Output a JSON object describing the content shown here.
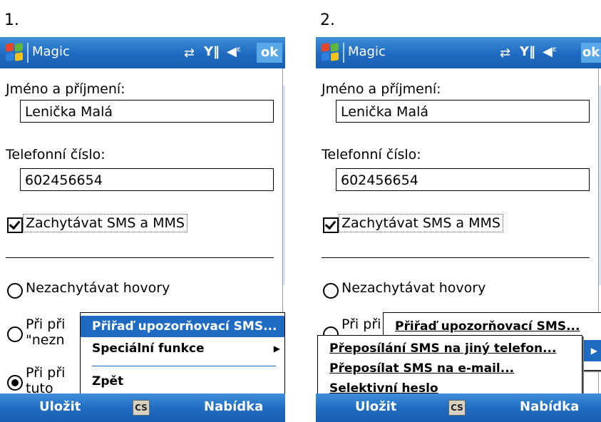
{
  "steps": [
    "1.",
    "2."
  ],
  "app_title": "Magic",
  "ok_label": "ok",
  "form": {
    "name_label": "Jméno a příjmení:",
    "name_value": "Lenička Malá",
    "phone_label": "Telefonní číslo:",
    "phone_value": "602456654",
    "checkbox_label": "Zachytávat SMS a MMS",
    "checkbox_checked": true,
    "radio1_label": "Nezachytávat hovory",
    "radio2_label_l1": "Při při",
    "radio2_label_l2": "\"nezn",
    "radio3_label_l1": "Při při",
    "radio3_label_l2": "tuto"
  },
  "menu1": {
    "items": [
      "Přiřaď upozorňovací SMS...",
      "Speciální funkce",
      "Zpět"
    ]
  },
  "menu2": {
    "top_item": "Přiřaď upozorňovací SMS...",
    "sub_items": [
      "Přeposílání SMS na jiný telefon...",
      "Přeposílat SMS na e-mail...",
      "Selektivní heslo"
    ]
  },
  "softkeys": {
    "left": "Uložit",
    "center": "CS",
    "right": "Nabídka"
  },
  "colors": {
    "titlebar": "#1e6ac0",
    "menu_highlight": "#1f6bc3",
    "scroll_track": "#d9e6f5"
  }
}
